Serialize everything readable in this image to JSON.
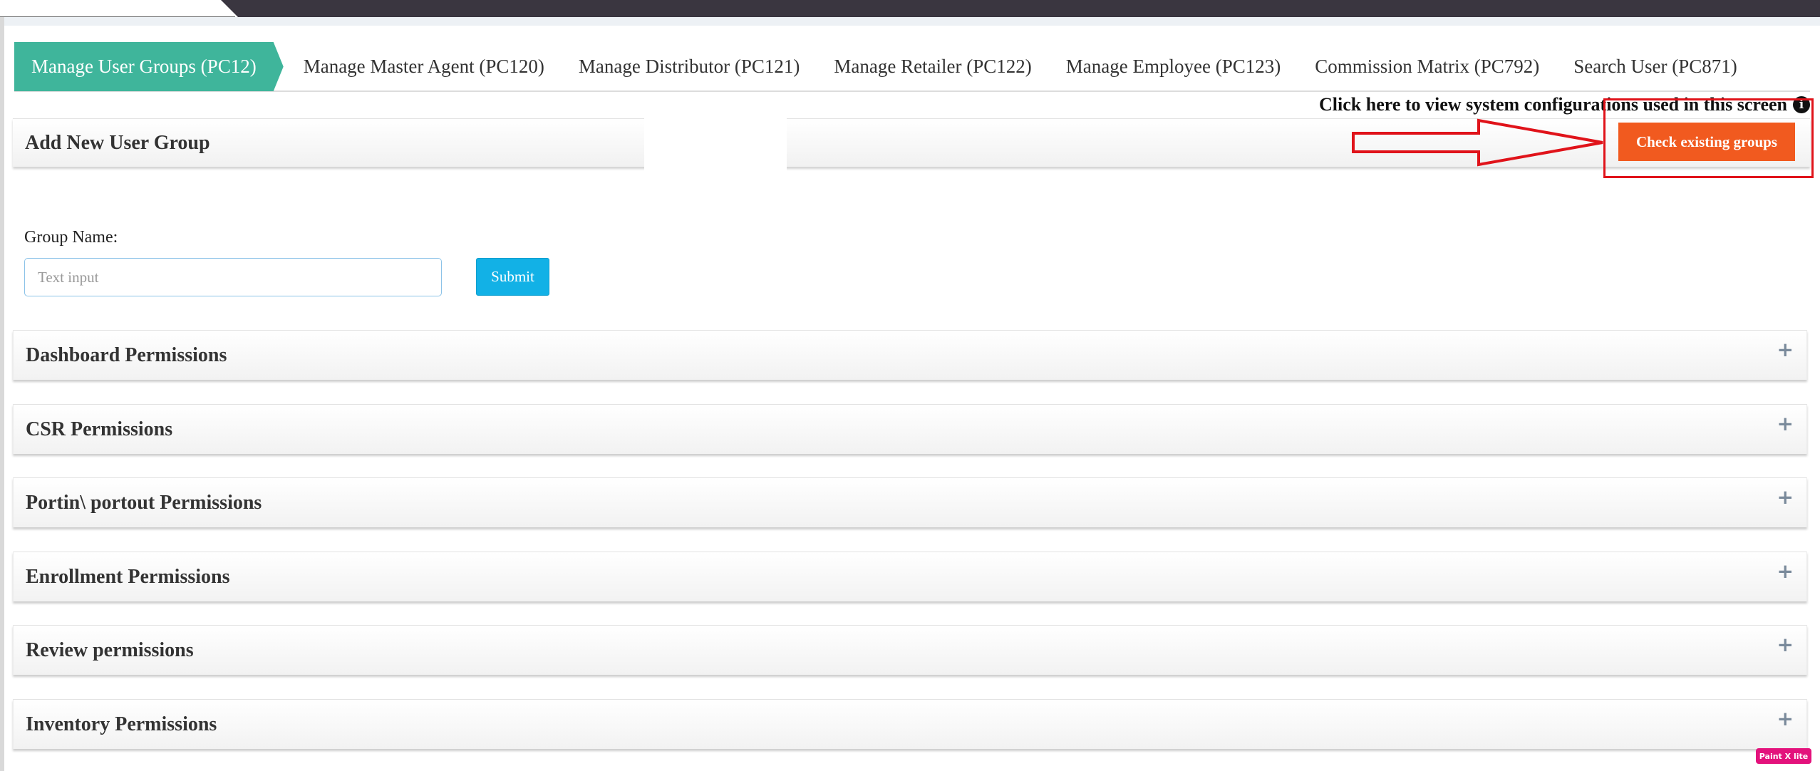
{
  "tabs": [
    {
      "label": "Manage User Groups (PC12)",
      "active": true
    },
    {
      "label": "Manage Master Agent (PC120)",
      "active": false
    },
    {
      "label": "Manage Distributor (PC121)",
      "active": false
    },
    {
      "label": "Manage Retailer (PC122)",
      "active": false
    },
    {
      "label": "Manage Employee (PC123)",
      "active": false
    },
    {
      "label": "Commission Matrix (PC792)",
      "active": false
    },
    {
      "label": "Search User (PC871)",
      "active": false
    }
  ],
  "config_link": {
    "text": "Click here to view system configurations used in this screen",
    "icon": "info-circle-icon"
  },
  "add_group": {
    "title": "Add New User Group",
    "check_button": "Check existing groups",
    "group_label": "Group Name:",
    "input_value": "",
    "input_placeholder": "Text input",
    "submit_label": "Submit"
  },
  "permissions": [
    {
      "title": "Dashboard Permissions"
    },
    {
      "title": "CSR Permissions"
    },
    {
      "title": "Portin\\ portout Permissions"
    },
    {
      "title": "Enrollment Permissions"
    },
    {
      "title": "Review permissions"
    },
    {
      "title": "Inventory Permissions"
    }
  ],
  "expand_symbol": "+",
  "badge": "Paint X lite",
  "colors": {
    "active_tab": "#3fb59b",
    "check_button": "#f15a1f",
    "submit_button": "#12b1e6",
    "annotation": "#e0131a",
    "topbar": "#3a3640"
  }
}
